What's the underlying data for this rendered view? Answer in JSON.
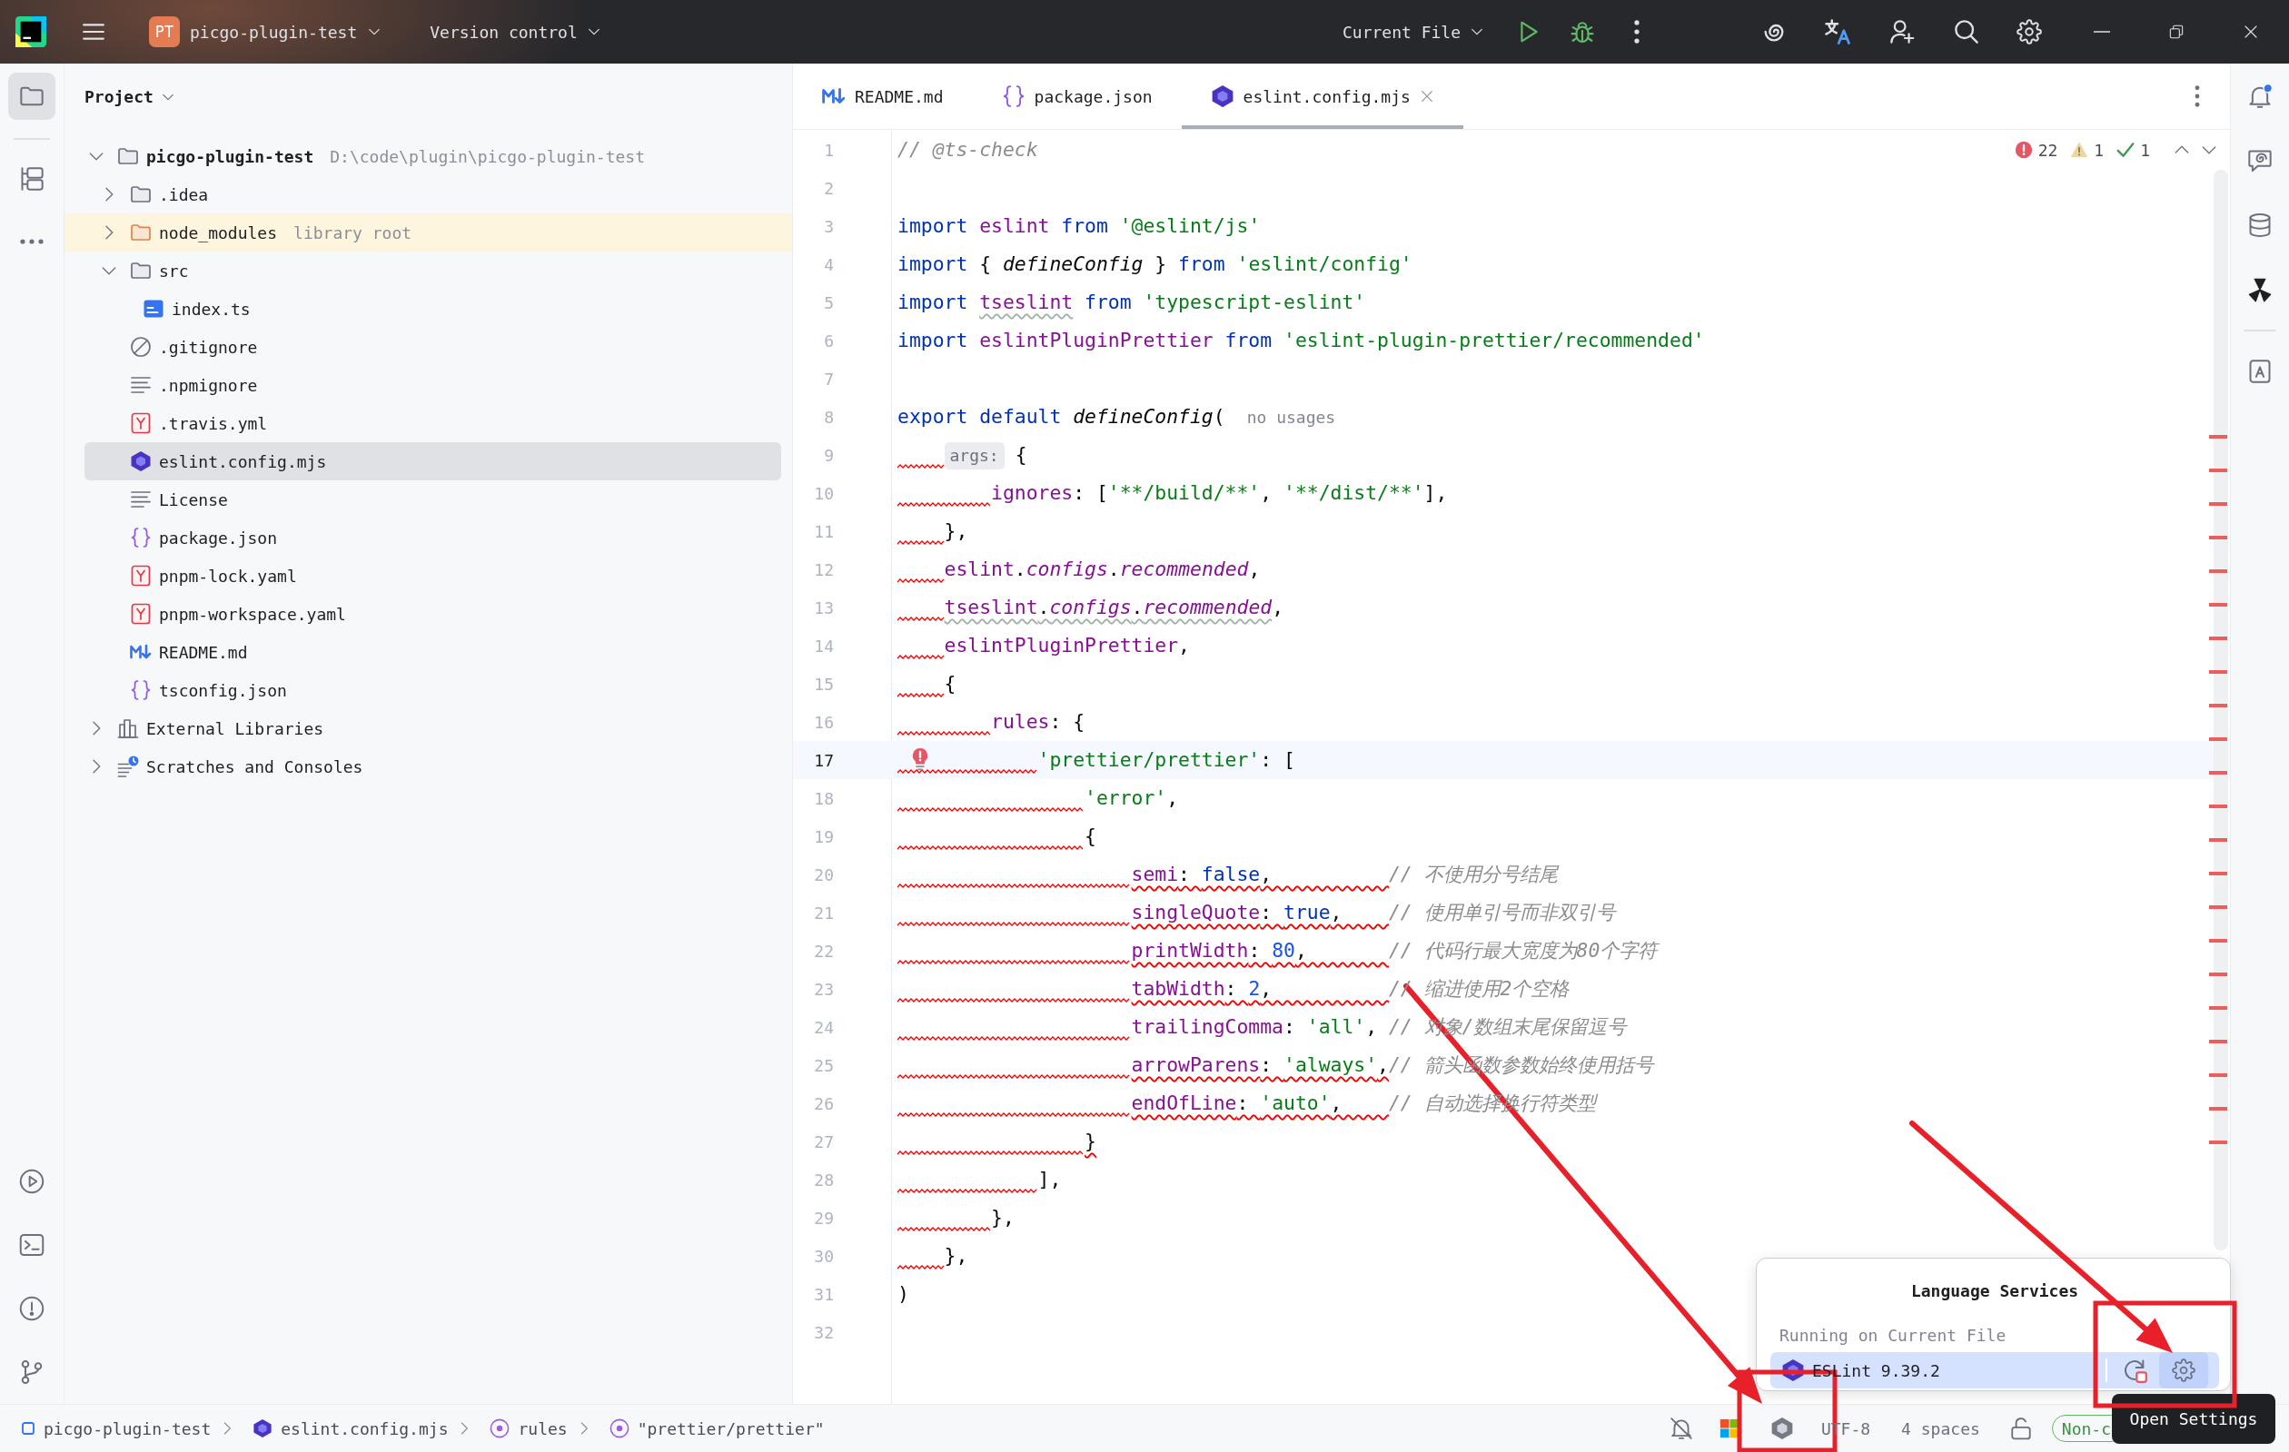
{
  "title_bar": {
    "project_badge": "PT",
    "project": "picgo-plugin-test",
    "vcs": "Version control",
    "run_config": "Current File"
  },
  "left_toolbar": {
    "top": [
      {
        "selected": true
      },
      {
        "selected": false
      },
      {
        "selected": false
      }
    ],
    "bottom": [
      {
        "selected": false
      },
      {
        "selected": false
      },
      {
        "selected": false
      },
      {
        "selected": false
      }
    ]
  },
  "project_panel": {
    "title": "Project",
    "tree": [
      {
        "label": "picgo-plugin-test",
        "note": "D:\\code\\plugin\\picgo-plugin-test",
        "kind": "project_folder",
        "expanded": true,
        "selected": false,
        "children": [
          {
            "label": ".idea",
            "kind": "folder",
            "expanded": false,
            "selected": false
          },
          {
            "label": "node_modules",
            "note": "library root",
            "kind": "library_folder",
            "expanded": false,
            "selected": false
          },
          {
            "label": "src",
            "kind": "folder",
            "expanded": true,
            "selected": false,
            "children": [
              {
                "label": "index.ts",
                "kind": "typescript",
                "selected": false
              }
            ]
          },
          {
            "label": ".gitignore",
            "kind": "ignore",
            "selected": false
          },
          {
            "label": ".npmignore",
            "kind": "text",
            "selected": false
          },
          {
            "label": ".travis.yml",
            "kind": "yaml",
            "selected": false
          },
          {
            "label": "eslint.config.mjs",
            "kind": "eslint",
            "selected": true
          },
          {
            "label": "License",
            "kind": "text",
            "selected": false
          },
          {
            "label": "package.json",
            "kind": "json",
            "selected": false
          },
          {
            "label": "pnpm-lock.yaml",
            "kind": "yaml",
            "selected": false
          },
          {
            "label": "pnpm-workspace.yaml",
            "kind": "yaml",
            "selected": false
          },
          {
            "label": "README.md",
            "kind": "markdown",
            "selected": false
          },
          {
            "label": "tsconfig.json",
            "kind": "json",
            "selected": false
          }
        ]
      },
      {
        "label": "External Libraries",
        "kind": "libraries",
        "expanded": false,
        "selected": false
      },
      {
        "label": "Scratches and Consoles",
        "kind": "scratches",
        "expanded": false,
        "selected": false
      }
    ]
  },
  "editor": {
    "tabs": [
      {
        "label": "README.md",
        "kind": "markdown",
        "selected": false
      },
      {
        "label": "package.json",
        "kind": "json",
        "selected": false
      },
      {
        "label": "eslint.config.mjs",
        "kind": "eslint",
        "selected": true
      }
    ],
    "inspections": [
      {
        "kind": "error",
        "count": "22"
      },
      {
        "kind": "warning",
        "count": "1"
      },
      {
        "kind": "passed",
        "count": "1"
      }
    ],
    "lines": [
      {
        "number": "1",
        "current": false,
        "tokens": [
          {
            "text": "// @ts-check",
            "kind": "comment"
          }
        ]
      },
      {
        "number": "2",
        "current": false
      },
      {
        "number": "3",
        "current": false,
        "tokens": [
          {
            "text": "import ",
            "kind": "keyword"
          },
          {
            "text": "eslint ",
            "kind": "binding"
          },
          {
            "text": "from ",
            "kind": "keyword"
          },
          {
            "text": "'@eslint/js'",
            "kind": "string"
          }
        ]
      },
      {
        "number": "4",
        "current": false,
        "tokens": [
          {
            "text": "import ",
            "kind": "keyword"
          },
          {
            "text": "{ ",
            "kind": "plain"
          },
          {
            "text": "defineConfig",
            "kind": "function"
          },
          {
            "text": " } ",
            "kind": "plain"
          },
          {
            "text": "from ",
            "kind": "keyword"
          },
          {
            "text": "'eslint/config'",
            "kind": "string"
          }
        ]
      },
      {
        "number": "5",
        "current": false,
        "tokens": [
          {
            "text": "import ",
            "kind": "keyword"
          },
          {
            "text": "tseslint",
            "kind": "binding",
            "warning": true
          },
          {
            "text": " from ",
            "kind": "keyword"
          },
          {
            "text": "'typescript-eslint'",
            "kind": "string"
          }
        ]
      },
      {
        "number": "6",
        "current": false,
        "tokens": [
          {
            "text": "import ",
            "kind": "keyword"
          },
          {
            "text": "eslintPluginPrettier ",
            "kind": "binding"
          },
          {
            "text": "from ",
            "kind": "keyword"
          },
          {
            "text": "'eslint-plugin-prettier/recommended'",
            "kind": "string"
          }
        ]
      },
      {
        "number": "7",
        "current": false
      },
      {
        "number": "8",
        "current": false,
        "tokens": [
          {
            "text": "export default ",
            "kind": "keyword"
          },
          {
            "text": "defineConfig",
            "kind": "function"
          },
          {
            "text": "(",
            "kind": "plain"
          },
          {
            "text": "no usages",
            "kind": "usage"
          }
        ]
      },
      {
        "number": "9",
        "current": false,
        "indent_error": true,
        "tokens": [
          {
            "text": "    args:",
            "kind": "hint"
          },
          {
            "text": "{",
            "kind": "plain"
          }
        ]
      },
      {
        "number": "10",
        "current": false,
        "indent_error": true,
        "tokens": [
          {
            "text": "        ignores",
            "kind": "property"
          },
          {
            "text": ": [",
            "kind": "plain"
          },
          {
            "text": "'**/build/**'",
            "kind": "string"
          },
          {
            "text": ", ",
            "kind": "plain"
          },
          {
            "text": "'**/dist/**'",
            "kind": "string"
          },
          {
            "text": "],",
            "kind": "plain"
          }
        ]
      },
      {
        "number": "11",
        "current": false,
        "indent_error": true,
        "tokens": [
          {
            "text": "    },",
            "kind": "plain"
          }
        ]
      },
      {
        "number": "12",
        "current": false,
        "indent_error": true,
        "tokens": [
          {
            "text": "    eslint",
            "kind": "binding"
          },
          {
            "text": ".",
            "kind": "plain"
          },
          {
            "text": "configs",
            "kind": "member"
          },
          {
            "text": ".",
            "kind": "plain"
          },
          {
            "text": "recommended",
            "kind": "member"
          },
          {
            "text": ",",
            "kind": "plain"
          }
        ]
      },
      {
        "number": "13",
        "current": false,
        "indent_error": true,
        "tokens": [
          {
            "text": "    tseslint",
            "kind": "binding",
            "warning": true
          },
          {
            "text": ".",
            "kind": "plain",
            "warning": true
          },
          {
            "text": "configs",
            "kind": "member",
            "warning": true
          },
          {
            "text": ".",
            "kind": "plain",
            "warning": true
          },
          {
            "text": "recommended",
            "kind": "member",
            "warning": true
          },
          {
            "text": ",",
            "kind": "plain"
          }
        ]
      },
      {
        "number": "14",
        "current": false,
        "indent_error": true,
        "tokens": [
          {
            "text": "    eslintPluginPrettier",
            "kind": "binding"
          },
          {
            "text": ",",
            "kind": "plain"
          }
        ]
      },
      {
        "number": "15",
        "current": false,
        "indent_error": true,
        "tokens": [
          {
            "text": "    {",
            "kind": "plain"
          }
        ]
      },
      {
        "number": "16",
        "current": false,
        "indent_error": true,
        "tokens": [
          {
            "text": "        rules",
            "kind": "property"
          },
          {
            "text": ": {",
            "kind": "plain"
          }
        ]
      },
      {
        "number": "17",
        "current": true,
        "indent_error": true,
        "error_bulb": true,
        "tokens": [
          {
            "text": "            'prettier/prettier'",
            "kind": "string"
          },
          {
            "text": ": [",
            "kind": "plain"
          }
        ]
      },
      {
        "number": "18",
        "current": false,
        "indent_error": true,
        "tokens": [
          {
            "text": "                'error'",
            "kind": "string"
          },
          {
            "text": ",",
            "kind": "plain"
          }
        ]
      },
      {
        "number": "19",
        "current": false,
        "indent_error": true,
        "tokens": [
          {
            "text": "                {",
            "kind": "plain"
          }
        ]
      },
      {
        "number": "20",
        "current": false,
        "indent_error": true,
        "tokens": [
          {
            "text": "                    semi",
            "kind": "property",
            "error": true
          },
          {
            "text": ": ",
            "kind": "plain",
            "error": true
          },
          {
            "text": "false",
            "kind": "literal",
            "error": true
          },
          {
            "text": ",          ",
            "kind": "plain",
            "error": true
          },
          {
            "text": "// 不使用分号结尾",
            "kind": "comment"
          }
        ]
      },
      {
        "number": "21",
        "current": false,
        "indent_error": true,
        "tokens": [
          {
            "text": "                    singleQuote",
            "kind": "property",
            "error": true
          },
          {
            "text": ": ",
            "kind": "plain",
            "error": true
          },
          {
            "text": "true",
            "kind": "literal",
            "error": true
          },
          {
            "text": ",    ",
            "kind": "plain",
            "error": true
          },
          {
            "text": "// 使用单引号而非双引号",
            "kind": "comment"
          }
        ]
      },
      {
        "number": "22",
        "current": false,
        "indent_error": true,
        "tokens": [
          {
            "text": "                    printWidth",
            "kind": "property",
            "error": true
          },
          {
            "text": ": ",
            "kind": "plain",
            "error": true
          },
          {
            "text": "80",
            "kind": "number",
            "error": true
          },
          {
            "text": ",       ",
            "kind": "plain",
            "error": true
          },
          {
            "text": "// 代码行最大宽度为80个字符",
            "kind": "comment"
          }
        ]
      },
      {
        "number": "23",
        "current": false,
        "indent_error": true,
        "tokens": [
          {
            "text": "                    tabWidth",
            "kind": "property",
            "error": true
          },
          {
            "text": ": ",
            "kind": "plain",
            "error": true
          },
          {
            "text": "2",
            "kind": "number",
            "error": true
          },
          {
            "text": ",          ",
            "kind": "plain",
            "error": true
          },
          {
            "text": "// 缩进使用2个空格",
            "kind": "comment"
          }
        ]
      },
      {
        "number": "24",
        "current": false,
        "indent_error": true,
        "tokens": [
          {
            "text": "                    trailingComma",
            "kind": "property"
          },
          {
            "text": ": ",
            "kind": "plain"
          },
          {
            "text": "'all'",
            "kind": "string"
          },
          {
            "text": ", ",
            "kind": "plain"
          },
          {
            "text": "// 对象/数组末尾保留逗号",
            "kind": "comment"
          }
        ]
      },
      {
        "number": "25",
        "current": false,
        "indent_error": true,
        "tokens": [
          {
            "text": "                    arrowParens",
            "kind": "property",
            "error": true
          },
          {
            "text": ": ",
            "kind": "plain",
            "error": true
          },
          {
            "text": "'always'",
            "kind": "string",
            "error": true
          },
          {
            "text": ",",
            "kind": "plain",
            "error": true
          },
          {
            "text": "// 箭头函数参数始终使用括号",
            "kind": "comment"
          }
        ]
      },
      {
        "number": "26",
        "current": false,
        "indent_error": true,
        "tokens": [
          {
            "text": "                    endOfLine",
            "kind": "property",
            "error": true
          },
          {
            "text": ": ",
            "kind": "plain",
            "error": true
          },
          {
            "text": "'auto'",
            "kind": "string",
            "error": true
          },
          {
            "text": ",    ",
            "kind": "plain",
            "error": true
          },
          {
            "text": "// 自动选择换行符类型",
            "kind": "comment"
          }
        ]
      },
      {
        "number": "27",
        "current": false,
        "indent_error": true,
        "tokens": [
          {
            "text": "                }",
            "kind": "plain",
            "error": true
          }
        ]
      },
      {
        "number": "28",
        "current": false,
        "indent_error": true,
        "tokens": [
          {
            "text": "            ],",
            "kind": "plain"
          }
        ]
      },
      {
        "number": "29",
        "current": false,
        "indent_error": true,
        "tokens": [
          {
            "text": "        },",
            "kind": "plain"
          }
        ]
      },
      {
        "number": "30",
        "current": false,
        "indent_error": true,
        "tokens": [
          {
            "text": "    },",
            "kind": "plain"
          }
        ]
      },
      {
        "number": "31",
        "current": false,
        "tokens": [
          {
            "text": ")",
            "kind": "plain"
          }
        ]
      },
      {
        "number": "32",
        "current": false
      }
    ]
  },
  "right_toolbar": [
    {
      "selected": false,
      "badge": true
    },
    {
      "selected": false
    },
    {
      "selected": false
    },
    {
      "selected": false
    },
    {
      "selected": false
    }
  ],
  "language_services": {
    "title": "Language Services",
    "section": "Running on Current File",
    "services": [
      {
        "name": "ESLint 9.39.2",
        "selected": true,
        "settings_hover": true
      }
    ]
  },
  "tooltip": "Open Settings",
  "status_bar": {
    "breadcrumbs": [
      {
        "label": "picgo-plugin-test",
        "kind": "module"
      },
      {
        "label": "eslint.config.mjs",
        "kind": "eslint"
      },
      {
        "label": "rules",
        "kind": "property"
      },
      {
        "label": "\"prettier/prettier\"",
        "kind": "property"
      }
    ],
    "encoding": "UTF-8",
    "indent": "4 spaces",
    "mode": "Non-c"
  },
  "annotations": [
    {
      "kind": "arrow"
    },
    {
      "kind": "arrow"
    },
    {
      "kind": "frame"
    },
    {
      "kind": "frame"
    }
  ]
}
